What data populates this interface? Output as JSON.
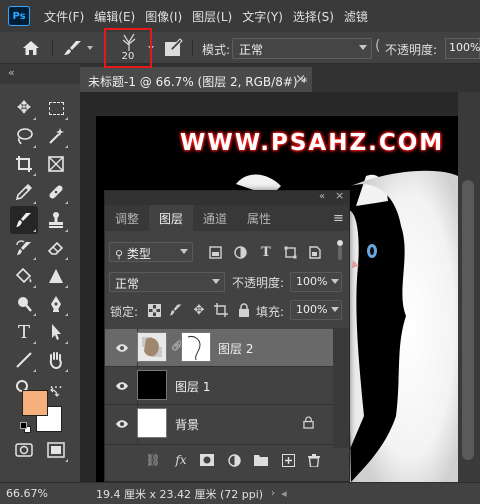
{
  "app": {
    "logo": "Ps"
  },
  "menu": [
    "文件(F)",
    "编辑(E)",
    "图像(I)",
    "图层(L)",
    "文字(Y)",
    "选择(S)",
    "滤镜"
  ],
  "options_bar": {
    "brush_size": "20",
    "mode_label": "模式:",
    "mode_value": "正常",
    "opacity_label": "不透明度:",
    "opacity_value": "100%"
  },
  "document": {
    "tab_title": "未标题-1 @ 66.7% (图层 2, RGB/8#) *",
    "watermark": "WWW.PSAHZ.COM"
  },
  "colors": {
    "foreground": "#f6b07c",
    "background": "#ffffff",
    "accent_highlight": "#e21a1a"
  },
  "status": {
    "zoom": "66.67%",
    "doc_info": "19.4 厘米 x 23.42 厘米 (72 ppi)"
  },
  "layers_panel": {
    "tabs": [
      "调整",
      "图层",
      "通道",
      "属性"
    ],
    "active_tab": "图层",
    "filter_type": "类型",
    "blend_mode": "正常",
    "opacity_label": "不透明度:",
    "opacity_value": "100%",
    "lock_label": "锁定:",
    "fill_label": "填充:",
    "fill_value": "100%",
    "layers": [
      {
        "name": "图层 2",
        "selected": true,
        "has_mask": true
      },
      {
        "name": "图层 1",
        "selected": false,
        "thumb": "black"
      },
      {
        "name": "背景",
        "selected": false,
        "thumb": "white",
        "locked": true
      }
    ]
  },
  "icons": {
    "toolbar": [
      "move-icon",
      "marquee-icon",
      "lasso-icon",
      "magic-wand-icon",
      "crop-icon",
      "frame-icon",
      "eyedropper-icon",
      "healing-icon",
      "brush-icon",
      "stamp-icon",
      "history-brush-icon",
      "eraser-icon",
      "paint-bucket-icon",
      "sharpen-icon",
      "dodge-icon",
      "pen-icon",
      "type-icon",
      "path-select-icon",
      "line-icon",
      "hand-icon",
      "zoom-icon",
      "more-icon"
    ]
  }
}
